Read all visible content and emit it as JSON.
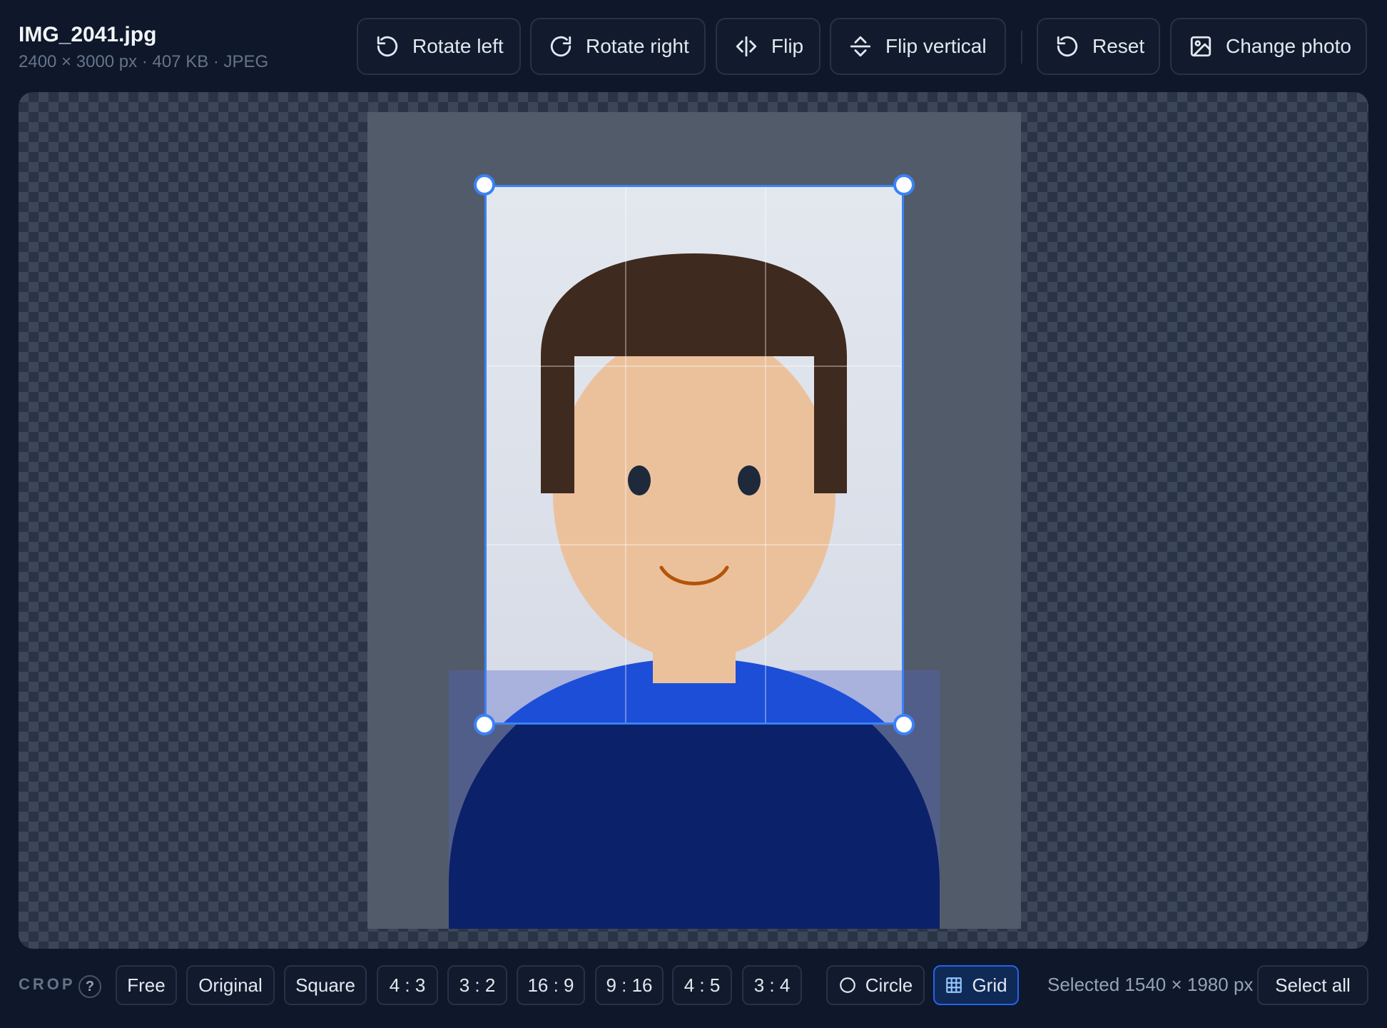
{
  "file": {
    "name": "IMG_2041.jpg",
    "meta": "2400 × 3000 px · 407 KB · JPEG"
  },
  "toolbar": {
    "rotate_left": "Rotate left",
    "rotate_right": "Rotate right",
    "flip": "Flip",
    "flip_vertical": "Flip vertical",
    "reset": "Reset",
    "change_photo": "Change photo"
  },
  "icons": {
    "rotate_left": "rotate-left-icon",
    "rotate_right": "rotate-right-icon",
    "flip": "flip-horizontal-icon",
    "flip_vertical": "flip-vertical-icon",
    "reset": "reset-icon",
    "change_photo": "image-icon",
    "circle": "circle-icon",
    "grid": "grid-icon"
  },
  "crop": {
    "label": "CROP",
    "help": "?",
    "ratios": [
      "Free",
      "Original",
      "Square",
      "4 : 3",
      "3 : 2",
      "16 : 9",
      "9 : 16",
      "4 : 5",
      "3 : 4"
    ],
    "circle_label": "Circle",
    "grid_label": "Grid",
    "grid_enabled": true,
    "selected_text": "Selected 1540 × 1980 px",
    "select_all": "Select all"
  },
  "colors": {
    "accent": "#3b82f6",
    "background": "#0f172a",
    "hair": "#3f2a1f",
    "skin": "#ebc19c",
    "shirt_dark": "#0b216a",
    "shirt_light": "#1d4ed8"
  }
}
